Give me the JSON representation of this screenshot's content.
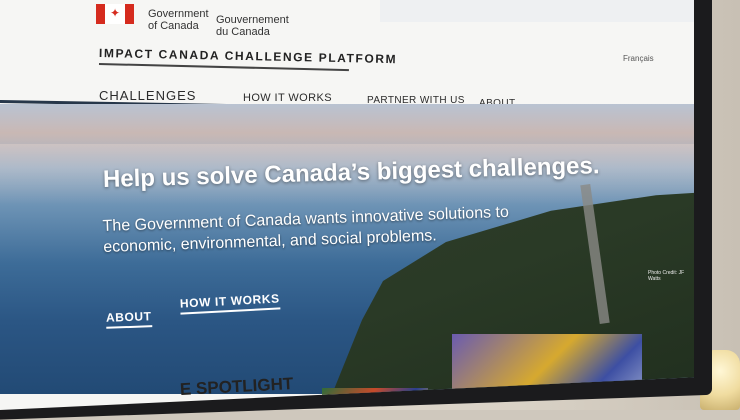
{
  "header": {
    "gov_en_line1": "Government",
    "gov_en_line2": "of Canada",
    "gov_fr_line1": "Gouvernement",
    "gov_fr_line2": "du Canada",
    "language_link": "Français",
    "platform_title": "IMPACT CANADA CHALLENGE PLATFORM"
  },
  "nav": {
    "items": [
      {
        "label": "CHALLENGES"
      },
      {
        "label": "HOW IT WORKS"
      },
      {
        "label": "PARTNER WITH US"
      },
      {
        "label": "ABOUT"
      }
    ]
  },
  "hero": {
    "headline": "Help us solve Canada’s biggest challenges.",
    "subtext": "The Government of Canada wants innovative solutions to economic, environmental, and social problems.",
    "links": [
      {
        "label": "ABOUT"
      },
      {
        "label": "HOW IT WORKS"
      }
    ],
    "photo_credit": "Photo Credit: JF Watts"
  },
  "below": {
    "section_title_fragment": "E SPOTLIGHT"
  },
  "colors": {
    "flag_red": "#d52b1e",
    "nav_rule": "#26374a"
  }
}
